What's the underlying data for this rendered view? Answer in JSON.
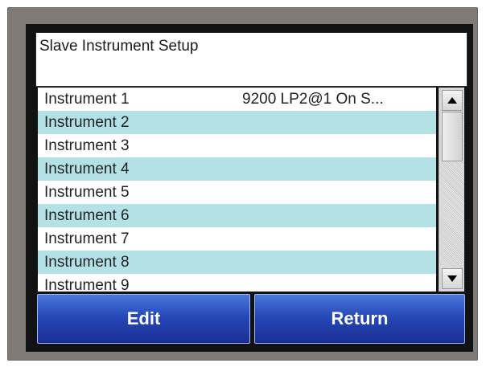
{
  "screen": {
    "title": "Slave Instrument Setup"
  },
  "instruments": [
    {
      "name": "Instrument 1",
      "value": "9200 LP2@1 On S..."
    },
    {
      "name": "Instrument 2",
      "value": ""
    },
    {
      "name": "Instrument 3",
      "value": ""
    },
    {
      "name": "Instrument 4",
      "value": ""
    },
    {
      "name": "Instrument 5",
      "value": ""
    },
    {
      "name": "Instrument 6",
      "value": ""
    },
    {
      "name": "Instrument 7",
      "value": ""
    },
    {
      "name": "Instrument 8",
      "value": ""
    },
    {
      "name": "Instrument 9",
      "value": ""
    }
  ],
  "buttons": {
    "edit_label": "Edit",
    "return_label": "Return"
  },
  "colors": {
    "alt_row": "#b4e1e6",
    "button_blue": "#2648b8",
    "bezel": "#7f7a76"
  },
  "icons": {
    "scroll_up": "triangle-up-icon",
    "scroll_down": "triangle-down-icon"
  }
}
